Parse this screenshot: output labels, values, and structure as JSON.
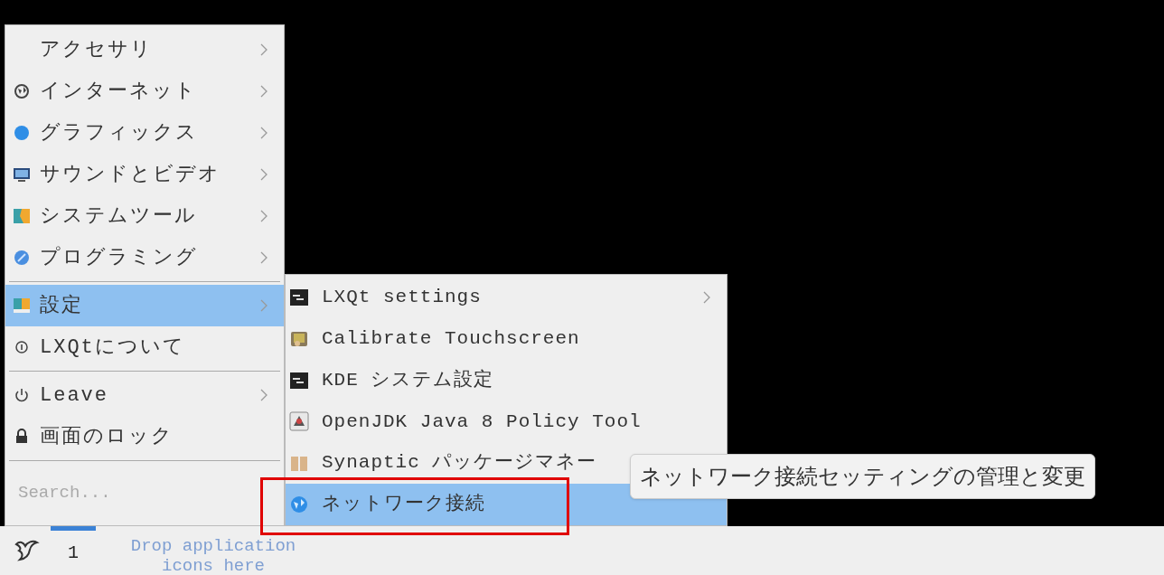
{
  "main_menu": {
    "items": [
      {
        "kind": "item",
        "label": "アクセサリ",
        "has_submenu": true,
        "selected": false
      },
      {
        "kind": "item",
        "label": "インターネット",
        "has_submenu": true,
        "selected": false
      },
      {
        "kind": "item",
        "label": "グラフィックス",
        "has_submenu": true,
        "selected": false
      },
      {
        "kind": "item",
        "label": "サウンドとビデオ",
        "has_submenu": true,
        "selected": false
      },
      {
        "kind": "item",
        "label": "システムツール",
        "has_submenu": true,
        "selected": false
      },
      {
        "kind": "item",
        "label": "プログラミング",
        "has_submenu": true,
        "selected": false
      },
      {
        "kind": "separator"
      },
      {
        "kind": "item",
        "label": "設定",
        "has_submenu": true,
        "selected": true
      },
      {
        "kind": "item",
        "label": "LXQtについて",
        "has_submenu": false,
        "selected": false
      },
      {
        "kind": "separator"
      },
      {
        "kind": "item",
        "label": "Leave",
        "has_submenu": true,
        "selected": false
      },
      {
        "kind": "item",
        "label": "画面のロック",
        "has_submenu": false,
        "selected": false
      },
      {
        "kind": "separator"
      },
      {
        "kind": "search",
        "placeholder": "Search..."
      }
    ]
  },
  "submenu": {
    "items": [
      {
        "label": "LXQt settings",
        "has_submenu": true,
        "selected": false
      },
      {
        "label": "Calibrate Touchscreen",
        "has_submenu": false,
        "selected": false
      },
      {
        "label": "KDE システム設定",
        "has_submenu": false,
        "selected": false
      },
      {
        "label": "OpenJDK Java 8 Policy Tool",
        "has_submenu": false,
        "selected": false
      },
      {
        "label": "Synaptic パッケージマネー",
        "has_submenu": false,
        "selected": false
      },
      {
        "label": "ネットワーク接続",
        "has_submenu": false,
        "selected": true
      }
    ]
  },
  "tooltip": {
    "text": "ネットワーク接続セッティングの管理と変更"
  },
  "taskbar": {
    "workspaces": [
      {
        "label": "1",
        "selected": true
      }
    ],
    "quicklaunch_hint": "Drop application icons here"
  }
}
